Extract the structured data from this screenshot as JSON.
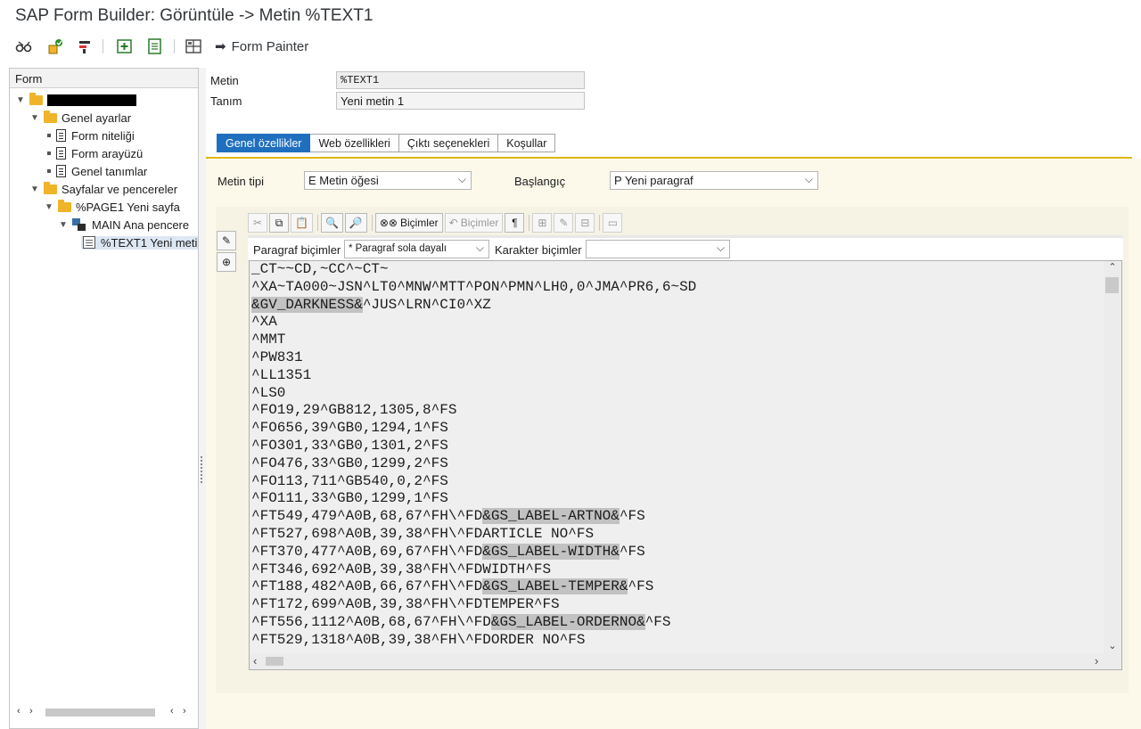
{
  "window": {
    "title": "SAP Form Builder: Görüntüle -> Metin %TEXT1"
  },
  "toolbar": {
    "icons": [
      "glasses-icon",
      "activate-icon",
      "check-icon",
      "new-window-icon",
      "hierarchy-icon",
      "layout-icon"
    ],
    "form_painter_label": "Form Painter"
  },
  "tree": {
    "header": "Form",
    "nodes": [
      {
        "label": "",
        "redacted": true
      },
      {
        "label": "Genel ayarlar"
      },
      {
        "label": "Form niteliği"
      },
      {
        "label": "Form arayüzü"
      },
      {
        "label": "Genel tanımlar"
      },
      {
        "label": "Sayfalar ve pencereler"
      },
      {
        "label": "%PAGE1 Yeni sayfa"
      },
      {
        "label": "MAIN Ana pencere"
      },
      {
        "label": "%TEXT1 Yeni metin 1"
      }
    ]
  },
  "header": {
    "metin_label": "Metin",
    "metin_value": "%TEXT1",
    "tanim_label": "Tanım",
    "tanim_value": "Yeni metin 1"
  },
  "tabs": [
    {
      "label": "Genel özellikler",
      "active": true
    },
    {
      "label": "Web özellikleri",
      "active": false
    },
    {
      "label": "Çıktı seçenekleri",
      "active": false
    },
    {
      "label": "Koşullar",
      "active": false
    }
  ],
  "text_type": {
    "label": "Metin tipi",
    "value": "E Metin öğesi"
  },
  "start": {
    "label": "Başlangıç",
    "value": "P Yeni paragraf"
  },
  "editor": {
    "bicimler_label": "Biçimler",
    "bicimler_disabled_label": "Biçimler",
    "paragraph_formats_label": "Paragraf biçimler",
    "paragraph_formats_value": "* Paragraf sola dayalı",
    "char_formats_label": "Karakter biçimler",
    "char_formats_value": ""
  },
  "code_lines": [
    [
      {
        "t": "_CT~~CD,~CC^~CT~"
      }
    ],
    [
      {
        "t": "^XA~TA000~JSN^LT0^MNW^MTT^PON^PMN^LH0,0^JMA^PR6,6~SD"
      }
    ],
    [
      {
        "t": "&GV_DARKNESS&",
        "h": true
      },
      {
        "t": "^JUS^LRN^CI0^XZ"
      }
    ],
    [
      {
        "t": "^XA"
      }
    ],
    [
      {
        "t": "^MMT"
      }
    ],
    [
      {
        "t": "^PW831"
      }
    ],
    [
      {
        "t": "^LL1351"
      }
    ],
    [
      {
        "t": "^LS0"
      }
    ],
    [
      {
        "t": "^FO19,29^GB812,1305,8^FS"
      }
    ],
    [
      {
        "t": "^FO656,39^GB0,1294,1^FS"
      }
    ],
    [
      {
        "t": "^FO301,33^GB0,1301,2^FS"
      }
    ],
    [
      {
        "t": "^FO476,33^GB0,1299,2^FS"
      }
    ],
    [
      {
        "t": "^FO113,711^GB540,0,2^FS"
      }
    ],
    [
      {
        "t": "^FO111,33^GB0,1299,1^FS"
      }
    ],
    [
      {
        "t": "^FT549,479^A0B,68,67^FH\\^FD"
      },
      {
        "t": "&GS_LABEL-ARTNO&",
        "h": true
      },
      {
        "t": "^FS"
      }
    ],
    [
      {
        "t": "^FT527,698^A0B,39,38^FH\\^FDARTICLE NO^FS"
      }
    ],
    [
      {
        "t": "^FT370,477^A0B,69,67^FH\\^FD"
      },
      {
        "t": "&GS_LABEL-WIDTH&",
        "h": true
      },
      {
        "t": "^FS"
      }
    ],
    [
      {
        "t": "^FT346,692^A0B,39,38^FH\\^FDWIDTH^FS"
      }
    ],
    [
      {
        "t": "^FT188,482^A0B,66,67^FH\\^FD"
      },
      {
        "t": "&GS_LABEL-TEMPER&",
        "h": true
      },
      {
        "t": "^FS"
      }
    ],
    [
      {
        "t": "^FT172,699^A0B,39,38^FH\\^FDTEMPER^FS"
      }
    ],
    [
      {
        "t": "^FT556,1112^A0B,68,67^FH\\^FD"
      },
      {
        "t": "&GS_LABEL-ORDERNO&",
        "h": true
      },
      {
        "t": "^FS"
      }
    ],
    [
      {
        "t": "^FT529,1318^A0B,39,38^FH\\^FDORDER NO^FS"
      }
    ]
  ]
}
